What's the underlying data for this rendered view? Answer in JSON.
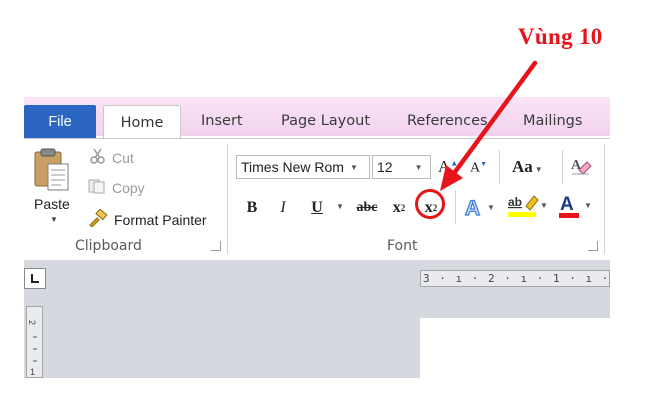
{
  "annotation": {
    "label": "Vùng 10"
  },
  "tabs": {
    "file": "File",
    "home": "Home",
    "insert": "Insert",
    "page_layout": "Page Layout",
    "references": "References",
    "mailings": "Mailings"
  },
  "clipboard": {
    "paste": "Paste",
    "cut": "Cut",
    "copy": "Copy",
    "format_painter": "Format Painter",
    "group_label": "Clipboard"
  },
  "font": {
    "font_name": "Times New Rom",
    "font_size": "12",
    "change_case": "Aa",
    "group_label": "Font",
    "bold": "B",
    "italic": "I",
    "underline": "U",
    "strikethrough": "abc",
    "subscript": "x",
    "subscript_mark": "2",
    "superscript": "x",
    "superscript_mark": "2",
    "highlight_letters": "ab",
    "font_color_letter": "A"
  },
  "ruler": {
    "horizontal_text": "3 · ı · 2 · ı · 1 · ı · | · ı"
  },
  "colors": {
    "accent_red": "#e8141b",
    "file_tab_blue": "#2b66c2",
    "tabstrip_pink": "#f3d7f0"
  },
  "icons": [
    "paste-icon",
    "scissors-icon",
    "copy-icon",
    "paintbrush-icon",
    "grow-font-icon",
    "shrink-font-icon",
    "change-case-icon",
    "clear-formatting-icon",
    "text-effects-icon",
    "highlight-icon",
    "font-color-icon",
    "dialog-launcher-icon"
  ]
}
